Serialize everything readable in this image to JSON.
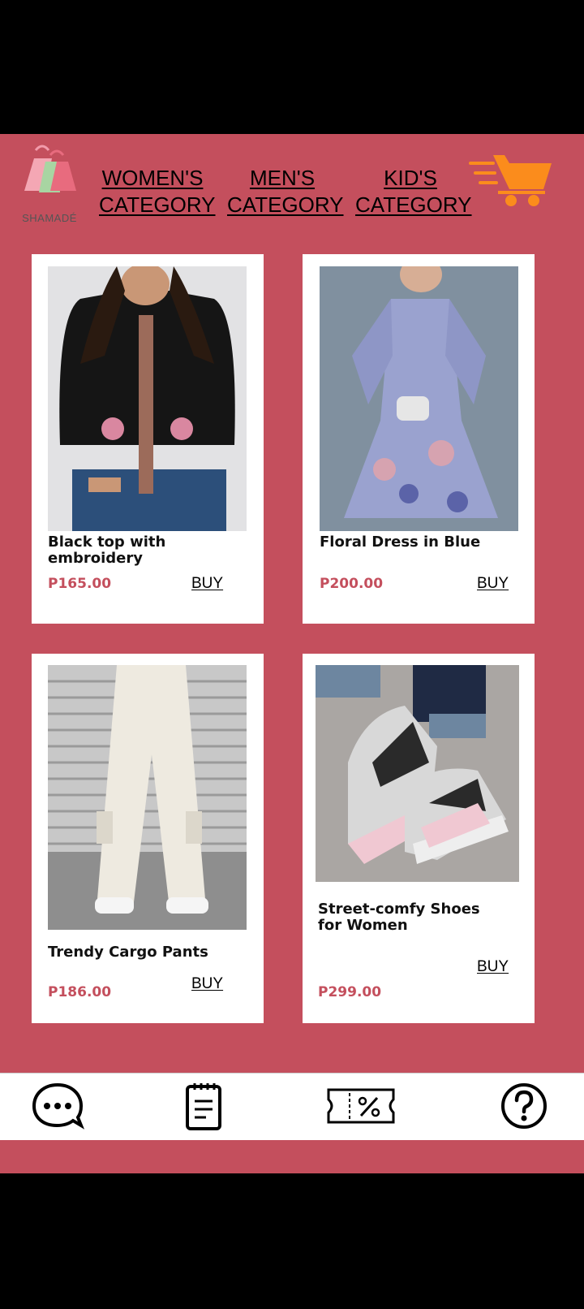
{
  "brand": {
    "name": "SHAMADÉ",
    "logo_icon": "shopping-bags-icon"
  },
  "nav": [
    {
      "line1": "WOMEN'S",
      "line2": "CATEGORY"
    },
    {
      "line1": "MEN'S",
      "line2": "CATEGORY"
    },
    {
      "line1": "KID'S",
      "line2": "CATEGORY"
    }
  ],
  "cart_icon": "cart-icon",
  "colors": {
    "background": "#c44f5d",
    "price": "#c44f5d",
    "cart": "#fb8c1c"
  },
  "products": [
    {
      "title": "Black top with embroidery",
      "price": "P165.00",
      "buy": "BUY"
    },
    {
      "title": "Floral Dress in Blue",
      "price": "P200.00",
      "buy": "BUY"
    },
    {
      "title": "Trendy Cargo Pants",
      "price": "P186.00",
      "buy": "BUY"
    },
    {
      "title": "Street-comfy Shoes for Women",
      "price": "P299.00",
      "buy": "BUY"
    }
  ],
  "bottom_nav": [
    "chat-icon",
    "notepad-icon",
    "coupon-icon",
    "help-icon"
  ]
}
